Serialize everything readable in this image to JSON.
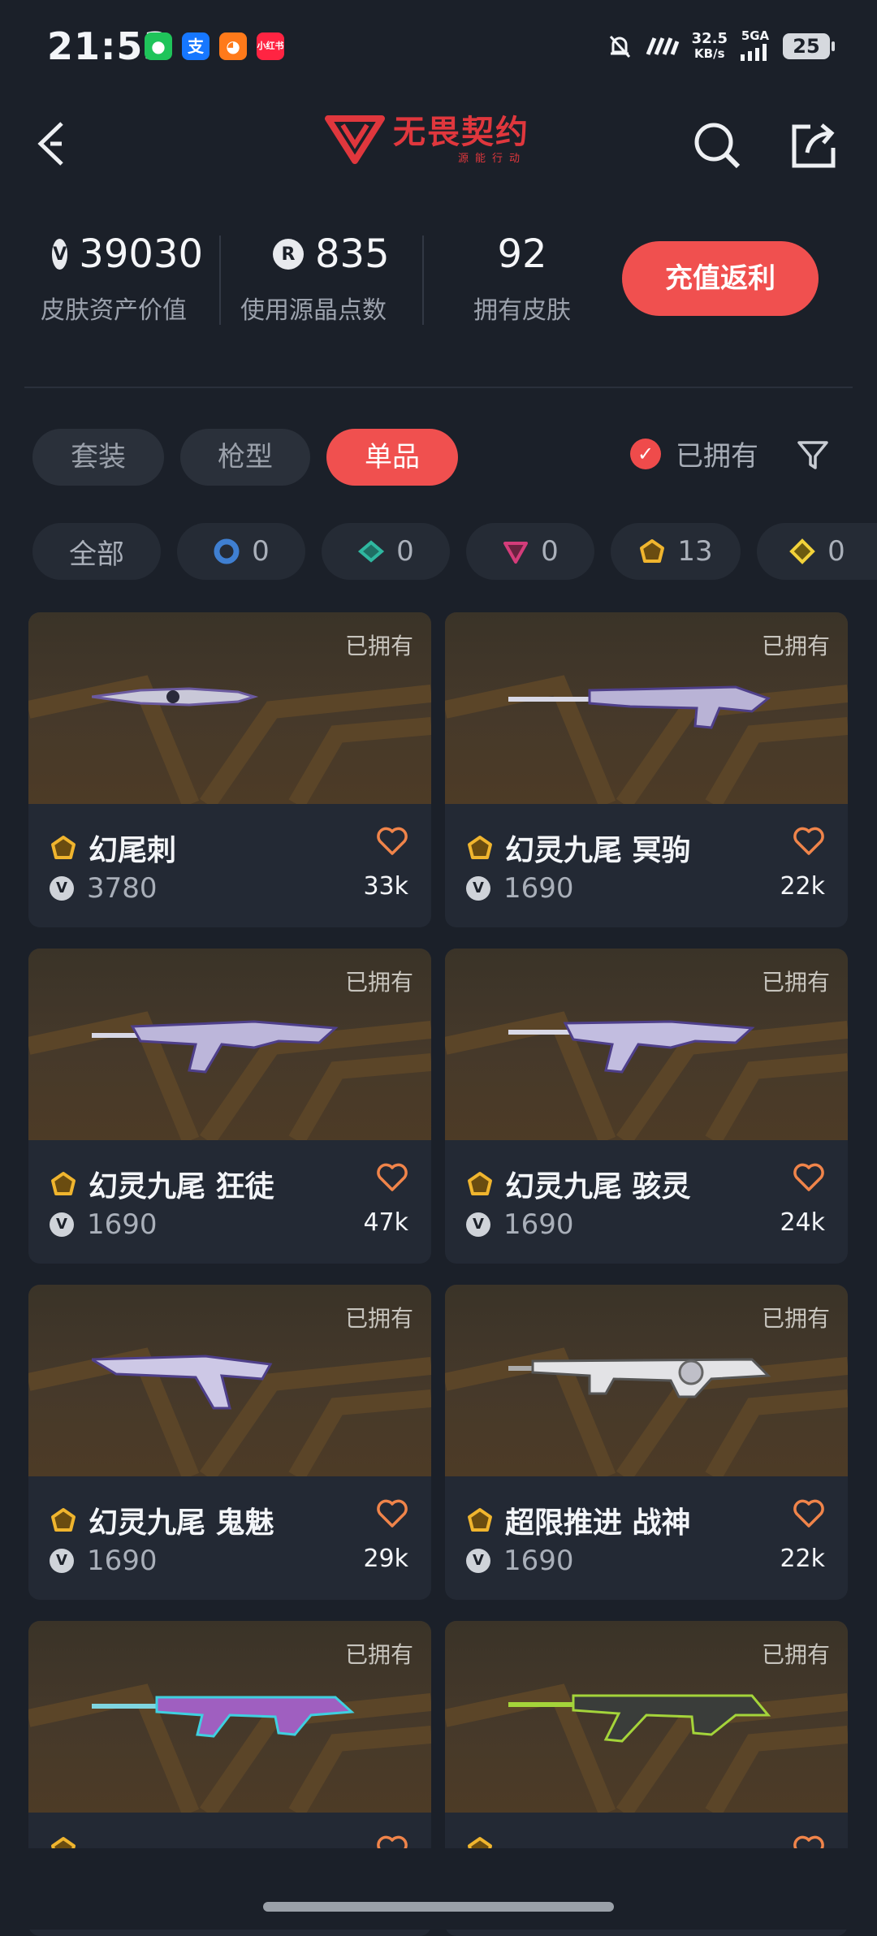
{
  "status_bar": {
    "time": "21:53",
    "net_speed": "32.5",
    "net_unit": "KB/s",
    "network": "5GA",
    "battery": "25",
    "notification_apps": [
      "wechat-icon",
      "alipay-icon",
      "taobao-icon",
      "xiaohongshu-icon"
    ]
  },
  "header": {
    "logo_title": "无畏契约",
    "logo_subtitle": "源能行动"
  },
  "stats": [
    {
      "value": "39030",
      "label": "皮肤资产价值",
      "icon": "vp-icon"
    },
    {
      "value": "835",
      "label": "使用源晶点数",
      "icon": "radianite-icon"
    },
    {
      "value": "92",
      "label": "拥有皮肤"
    }
  ],
  "recharge_button": "充值返利",
  "tabs": [
    "套装",
    "枪型",
    "单品"
  ],
  "active_tab": "单品",
  "owned_filter": "已拥有",
  "tier_chips": [
    {
      "label": "全部"
    },
    {
      "count": "0",
      "color": "#3f7fd1"
    },
    {
      "count": "0",
      "color": "#2fb7a0"
    },
    {
      "count": "0",
      "color": "#d43c7a"
    },
    {
      "count": "13",
      "color": "#f0b52e"
    },
    {
      "count": "0",
      "color": "#f2d23a"
    }
  ],
  "cards": [
    {
      "name": "幻尾刺",
      "price": "3780",
      "likes": "33k",
      "owned": "已拥有"
    },
    {
      "name": "幻灵九尾 冥驹",
      "price": "1690",
      "likes": "22k",
      "owned": "已拥有"
    },
    {
      "name": "幻灵九尾 狂徒",
      "price": "1690",
      "likes": "47k",
      "owned": "已拥有"
    },
    {
      "name": "幻灵九尾 骇灵",
      "price": "1690",
      "likes": "24k",
      "owned": "已拥有"
    },
    {
      "name": "幻灵九尾 鬼魅",
      "price": "1690",
      "likes": "29k",
      "owned": "已拥有"
    },
    {
      "name": "超限推进 战神",
      "price": "1690",
      "likes": "22k",
      "owned": "已拥有"
    },
    {
      "name": "",
      "price": "",
      "likes": "",
      "owned": "已拥有"
    },
    {
      "name": "",
      "price": "",
      "likes": "",
      "owned": "已拥有"
    }
  ],
  "colors": {
    "accent": "#f0504f",
    "gold_tier": "#f0b52e",
    "background": "#1b2029"
  }
}
